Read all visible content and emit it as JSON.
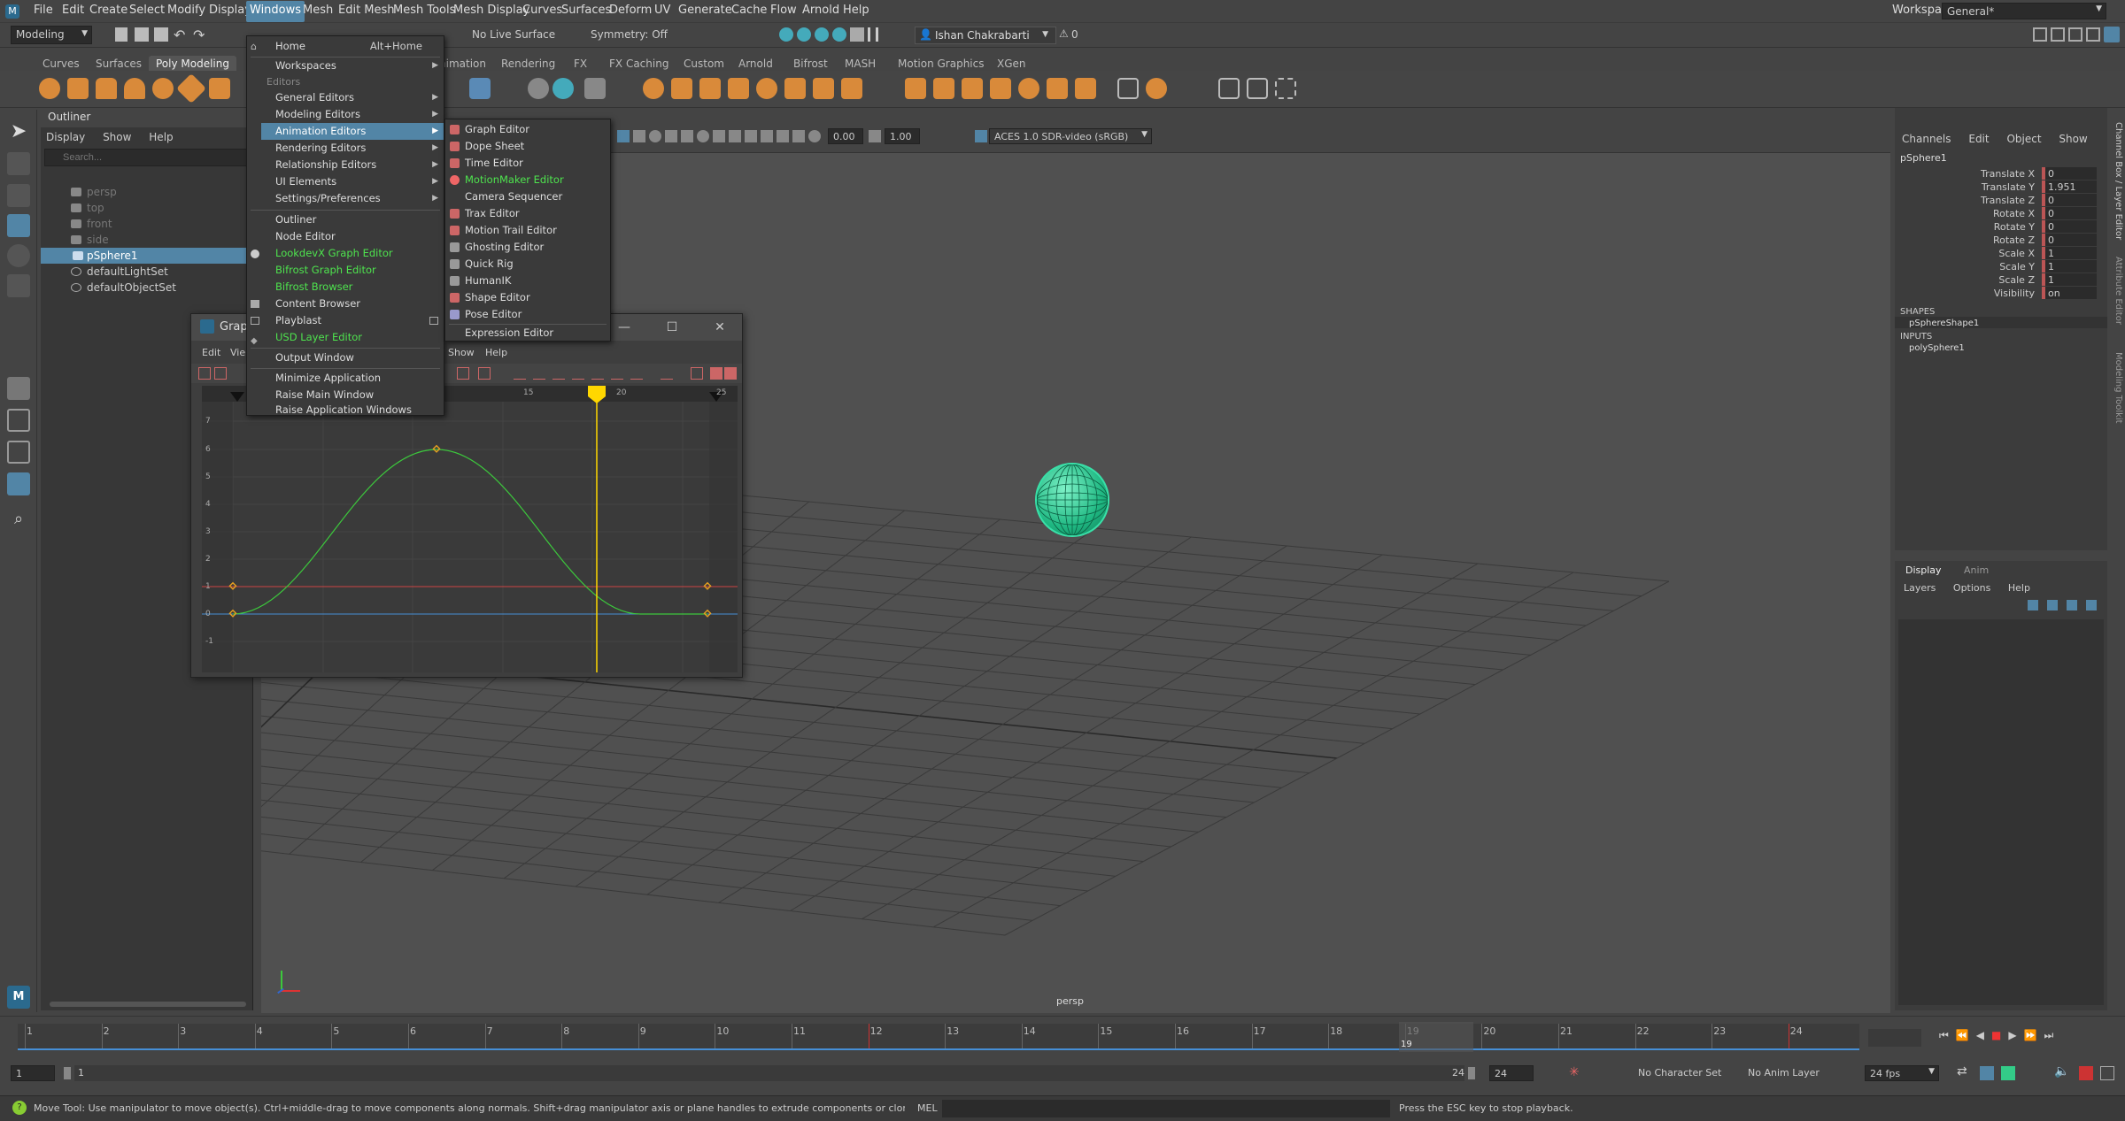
{
  "menubar": {
    "items": [
      "File",
      "Edit",
      "Create",
      "Select",
      "Modify",
      "Display",
      "Windows",
      "Mesh",
      "Edit Mesh",
      "Mesh Tools",
      "Mesh Display",
      "Curves",
      "Surfaces",
      "Deform",
      "UV",
      "Generate",
      "Cache",
      "Flow",
      "Arnold",
      "Help"
    ],
    "active": "Windows",
    "workspace_label": "Workspace:",
    "workspace_value": "General*"
  },
  "statusline": {
    "mode": "Modeling",
    "live_surface": "No Live Surface",
    "symmetry": "Symmetry: Off",
    "user": "Ishan Chakrabarti",
    "warnings": "0"
  },
  "shelf": {
    "tabs": [
      "Curves",
      "Surfaces",
      "Poly Modeling",
      "nimation",
      "Rendering",
      "FX",
      "FX Caching",
      "Custom",
      "Arnold",
      "Bifrost",
      "MASH",
      "Motion Graphics",
      "XGen"
    ],
    "active": "Poly Modeling"
  },
  "windows_menu": {
    "home": {
      "label": "Home",
      "shortcut": "Alt+Home"
    },
    "workspaces": "Workspaces",
    "editors_section": "Editors",
    "items": [
      {
        "label": "General Editors",
        "submenu": true
      },
      {
        "label": "Modeling Editors",
        "submenu": true
      },
      {
        "label": "Animation Editors",
        "submenu": true,
        "highlighted": true
      },
      {
        "label": "Rendering Editors",
        "submenu": true
      },
      {
        "label": "Relationship Editors",
        "submenu": true
      },
      {
        "label": "UI Elements",
        "submenu": true
      },
      {
        "label": "Settings/Preferences",
        "submenu": true
      }
    ],
    "items2": [
      "Outliner",
      "Node Editor"
    ],
    "green_items": [
      "LookdevX Graph Editor",
      "Bifrost Graph Editor",
      "Bifrost Browser"
    ],
    "items3": [
      "Content Browser",
      "Playblast"
    ],
    "usd": "USD Layer Editor",
    "output": "Output Window",
    "window_items": [
      "Minimize Application",
      "Raise Main Window",
      "Raise Application Windows"
    ]
  },
  "animation_submenu": {
    "items": [
      "Graph Editor",
      "Dope Sheet",
      "Time Editor",
      "MotionMaker Editor",
      "Camera Sequencer",
      "Trax Editor",
      "Motion Trail Editor",
      "Ghosting Editor",
      "Quick Rig",
      "HumanIK",
      "Shape Editor",
      "Pose Editor",
      "Expression Editor"
    ],
    "green_item": "MotionMaker Editor"
  },
  "outliner": {
    "title": "Outliner",
    "menus": [
      "Display",
      "Show",
      "Help"
    ],
    "search_placeholder": "Search...",
    "items": [
      {
        "label": "persp",
        "dim": true
      },
      {
        "label": "top",
        "dim": true
      },
      {
        "label": "front",
        "dim": true
      },
      {
        "label": "side",
        "dim": true
      },
      {
        "label": "pSphere1",
        "selected": true
      },
      {
        "label": "defaultLightSet"
      },
      {
        "label": "defaultObjectSet"
      }
    ]
  },
  "graph_editor": {
    "title": "Grap",
    "menus_left": [
      "Edit",
      "Vie"
    ],
    "menus_right": [
      "Show",
      "Help"
    ],
    "frame_labels": [
      "15",
      "20",
      "25"
    ],
    "y_labels": [
      "7",
      "6",
      "5",
      "4",
      "3",
      "2",
      "1",
      "0",
      "-1"
    ],
    "current_frame_label": "20"
  },
  "viewport": {
    "camera_label": "persp",
    "exposure": "0.00",
    "gamma": "1.00",
    "color_space": "ACES 1.0 SDR-video (sRGB)"
  },
  "channel_box": {
    "menus": [
      "Channels",
      "Edit",
      "Object",
      "Show"
    ],
    "object": "pSphere1",
    "channels": [
      {
        "label": "Translate X",
        "value": "0"
      },
      {
        "label": "Translate Y",
        "value": "1.951"
      },
      {
        "label": "Translate Z",
        "value": "0"
      },
      {
        "label": "Rotate X",
        "value": "0"
      },
      {
        "label": "Rotate Y",
        "value": "0"
      },
      {
        "label": "Rotate Z",
        "value": "0"
      },
      {
        "label": "Scale X",
        "value": "1"
      },
      {
        "label": "Scale Y",
        "value": "1"
      },
      {
        "label": "Scale Z",
        "value": "1"
      },
      {
        "label": "Visibility",
        "value": "on"
      }
    ],
    "shapes_label": "SHAPES",
    "shape": "pSphereShape1",
    "inputs_label": "INPUTS",
    "input": "polySphere1",
    "side_tabs": [
      "Channel Box / Layer Editor",
      "Attribute Editor",
      "Modeling Toolkit"
    ]
  },
  "layer_editor": {
    "tabs": [
      "Display",
      "Anim"
    ],
    "menus": [
      "Layers",
      "Options",
      "Help"
    ]
  },
  "timeline": {
    "ticks": [
      "1",
      "2",
      "3",
      "4",
      "5",
      "6",
      "7",
      "8",
      "9",
      "10",
      "11",
      "12",
      "13",
      "14",
      "15",
      "16",
      "17",
      "18",
      "19",
      "20",
      "21",
      "22",
      "23",
      "24"
    ],
    "current": "19"
  },
  "range": {
    "start": "1",
    "inner_start": "1",
    "inner_end": "24",
    "end": "24",
    "character_set": "No Character Set",
    "anim_layer": "No Anim Layer",
    "fps": "24 fps"
  },
  "helpline": {
    "message": "Move Tool: Use manipulator to move object(s). Ctrl+middle-drag to move components along normals. Shift+drag manipulator axis or plane handles to extrude components or clone objects. Ctrl+Shift+drag to constrain movement to a con",
    "mel": "MEL",
    "result": "Press the ESC key to stop playback."
  },
  "colors": {
    "highlight": "#5285a6",
    "green_text": "#4ee44e",
    "curve": "#3cc83c",
    "playhead": "#ffd700",
    "sphere": "#39e0a8"
  }
}
